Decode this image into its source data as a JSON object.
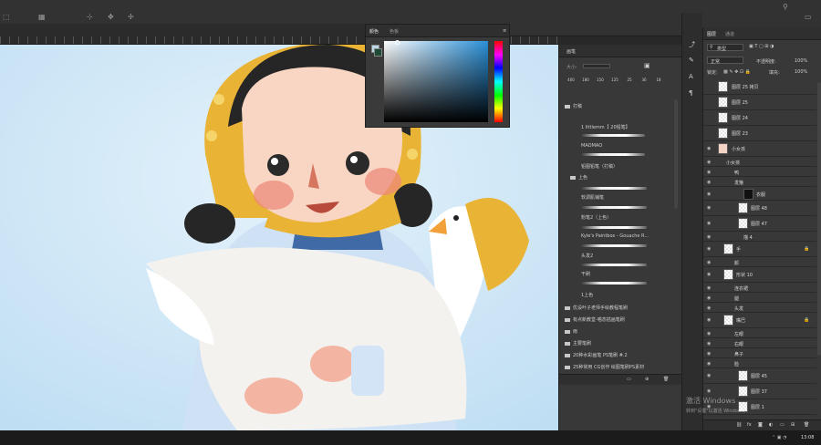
{
  "color_panel": {
    "tabs": [
      "颜色",
      "色板"
    ]
  },
  "brush_panel": {
    "title": "画笔",
    "size_label": "大小:",
    "preset_sizes": [
      "400",
      "180",
      "150",
      "125",
      "25",
      "30",
      "18"
    ],
    "group_open": "打稿",
    "brushes_1": [
      "1 littlemm【 20铅笔】",
      "MAOMAO",
      "铅图铅笔（打稿）"
    ],
    "group_color": "上色",
    "brushes_2": [
      "软调肌铺笔",
      "粉笔2（上色）",
      "Kyle's Paintbox - Gouache R...",
      "头发2",
      "干刷",
      "1上色"
    ],
    "folders": [
      "优设叶子老师手绘教程笔刷",
      "有点新教堂-喵态插画笔刷",
      "雨",
      "主要笔刷",
      "20种水彩画笔 PS笔刷 #.2",
      "25种常用 CG创作 绘图笔刷PS素材"
    ]
  },
  "layers_panel": {
    "tabs": [
      "图层",
      "通道"
    ],
    "filter_label": "类型",
    "blend_mode": "正常",
    "opacity_label": "不透明度:",
    "opacity_value": "100%",
    "lock_label": "锁定:",
    "fill_label": "填充:",
    "fill_value": "100%",
    "layers": [
      "图层 25 拷贝",
      "图层 25",
      "图层 24",
      "图层 23",
      "小女孩",
      "小女孩",
      "鸭",
      "发箍",
      "衣服",
      "图层 48",
      "图层 47",
      "描 4",
      "手",
      "颜",
      "形状 10",
      "连衣裙",
      "腿",
      "头发",
      "嘴巴",
      "左眼",
      "右眼",
      "鼻子",
      "脸",
      "图层 45",
      "图层 37",
      "图层 1"
    ]
  },
  "watermark": {
    "line1": "激活 Windows",
    "line2": "转到\"设置\"以激活 Windows。"
  },
  "clock": "13:08"
}
